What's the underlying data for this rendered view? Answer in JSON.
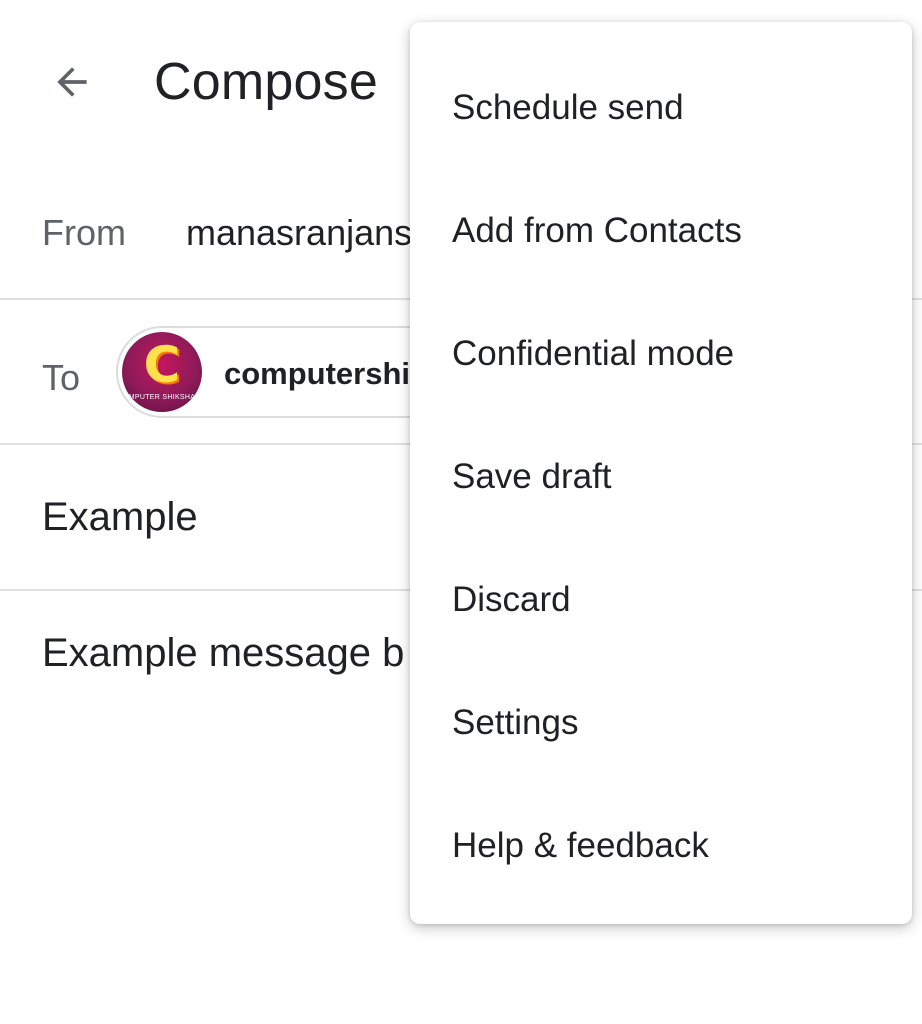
{
  "header": {
    "title": "Compose",
    "back_icon": "arrow-back-icon"
  },
  "from": {
    "label": "From",
    "value": "manasranjans"
  },
  "to": {
    "label": "To",
    "recipient": {
      "name": "computershi",
      "avatar_letter": "C",
      "avatar_caption": "MPUTER SHIKSHA"
    }
  },
  "subject": {
    "value": "Example"
  },
  "body": {
    "value": "Example message b"
  },
  "menu": {
    "items": [
      {
        "label": "Schedule send"
      },
      {
        "label": "Add from Contacts"
      },
      {
        "label": "Confidential mode"
      },
      {
        "label": "Save draft"
      },
      {
        "label": "Discard"
      },
      {
        "label": "Settings"
      },
      {
        "label": "Help & feedback"
      }
    ]
  },
  "colors": {
    "text_primary": "#202124",
    "text_secondary": "#5f6368",
    "divider": "#e0e0e0",
    "avatar_bg": "#c2185b",
    "avatar_letter": "#ffe14d"
  }
}
